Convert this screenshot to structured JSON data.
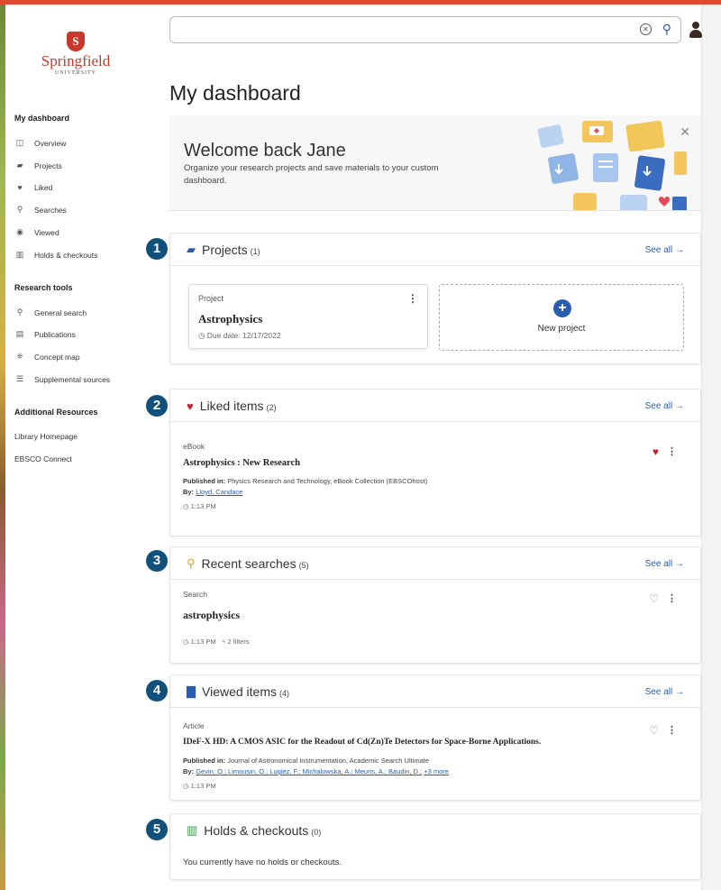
{
  "brand": {
    "name": "Springfield",
    "sub": "UNIVERSITY",
    "initial": "S"
  },
  "search": {
    "value": "",
    "placeholder": ""
  },
  "page_title": "My dashboard",
  "sidebar": {
    "section1": "My dashboard",
    "dashboard_items": [
      {
        "label": "Overview",
        "icon": "overview-icon"
      },
      {
        "label": "Projects",
        "icon": "folder-icon"
      },
      {
        "label": "Liked",
        "icon": "heart-icon"
      },
      {
        "label": "Searches",
        "icon": "search-icon"
      },
      {
        "label": "Viewed",
        "icon": "eye-icon"
      },
      {
        "label": "Holds & checkouts",
        "icon": "books-icon"
      }
    ],
    "section2": "Research tools",
    "tool_items": [
      {
        "label": "General search",
        "icon": "search-icon"
      },
      {
        "label": "Publications",
        "icon": "document-icon"
      },
      {
        "label": "Concept map",
        "icon": "concept-map-icon"
      },
      {
        "label": "Supplemental sources",
        "icon": "list-icon"
      }
    ],
    "section3": "Additional Resources",
    "resources": [
      "Library Homepage",
      "EBSCO Connect"
    ]
  },
  "welcome": {
    "title": "Welcome back Jane",
    "text": "Organize your research projects and save materials to your custom dashboard."
  },
  "see_all": "See all →",
  "projects": {
    "number": "1",
    "title": "Projects",
    "count": "(1)",
    "card": {
      "type": "Project",
      "name": "Astrophysics",
      "due": "Due date: 12/17/2022"
    },
    "new_label": "New project"
  },
  "liked": {
    "number": "2",
    "title": "Liked items",
    "count": "(2)",
    "item": {
      "type": "eBook",
      "title": "Astrophysics : New Research",
      "published_label": "Published in:",
      "published": "Physics Research and Technology, eBook Collection (EBSCOhost)",
      "by_label": "By:",
      "by": "Lloyd, Candace",
      "time": "1:13 PM"
    }
  },
  "searches": {
    "number": "3",
    "title": "Recent searches",
    "count": "(5)",
    "item": {
      "type": "Search",
      "title": "astrophysics",
      "time": "1:13 PM",
      "filters": "2 filters"
    }
  },
  "viewed": {
    "number": "4",
    "title": "Viewed items",
    "count": "(4)",
    "item": {
      "type": "Article",
      "title": "IDeF-X HD: A CMOS ASIC for the Readout of Cd(Zn)Te Detectors for Space-Borne Applications.",
      "published_label": "Published in:",
      "published": "Journal of Astronomical Instrumentation, Academic Search Ultimate",
      "by_label": "By:",
      "by": "Gevin, O.; Limousin, O.; Lugiez, F.; Michalowska, A.; Meuris, A.; Baudin, D.;",
      "more": "+3 more",
      "time": "1:13 PM"
    }
  },
  "holds": {
    "number": "5",
    "title": "Holds & checkouts",
    "count": "(0)",
    "empty": "You currently have no holds or checkouts."
  },
  "colors": {
    "accent": "#2a5db0",
    "badge": "#11507a",
    "topbar": "#e04a2f",
    "heart": "#c8202a"
  }
}
